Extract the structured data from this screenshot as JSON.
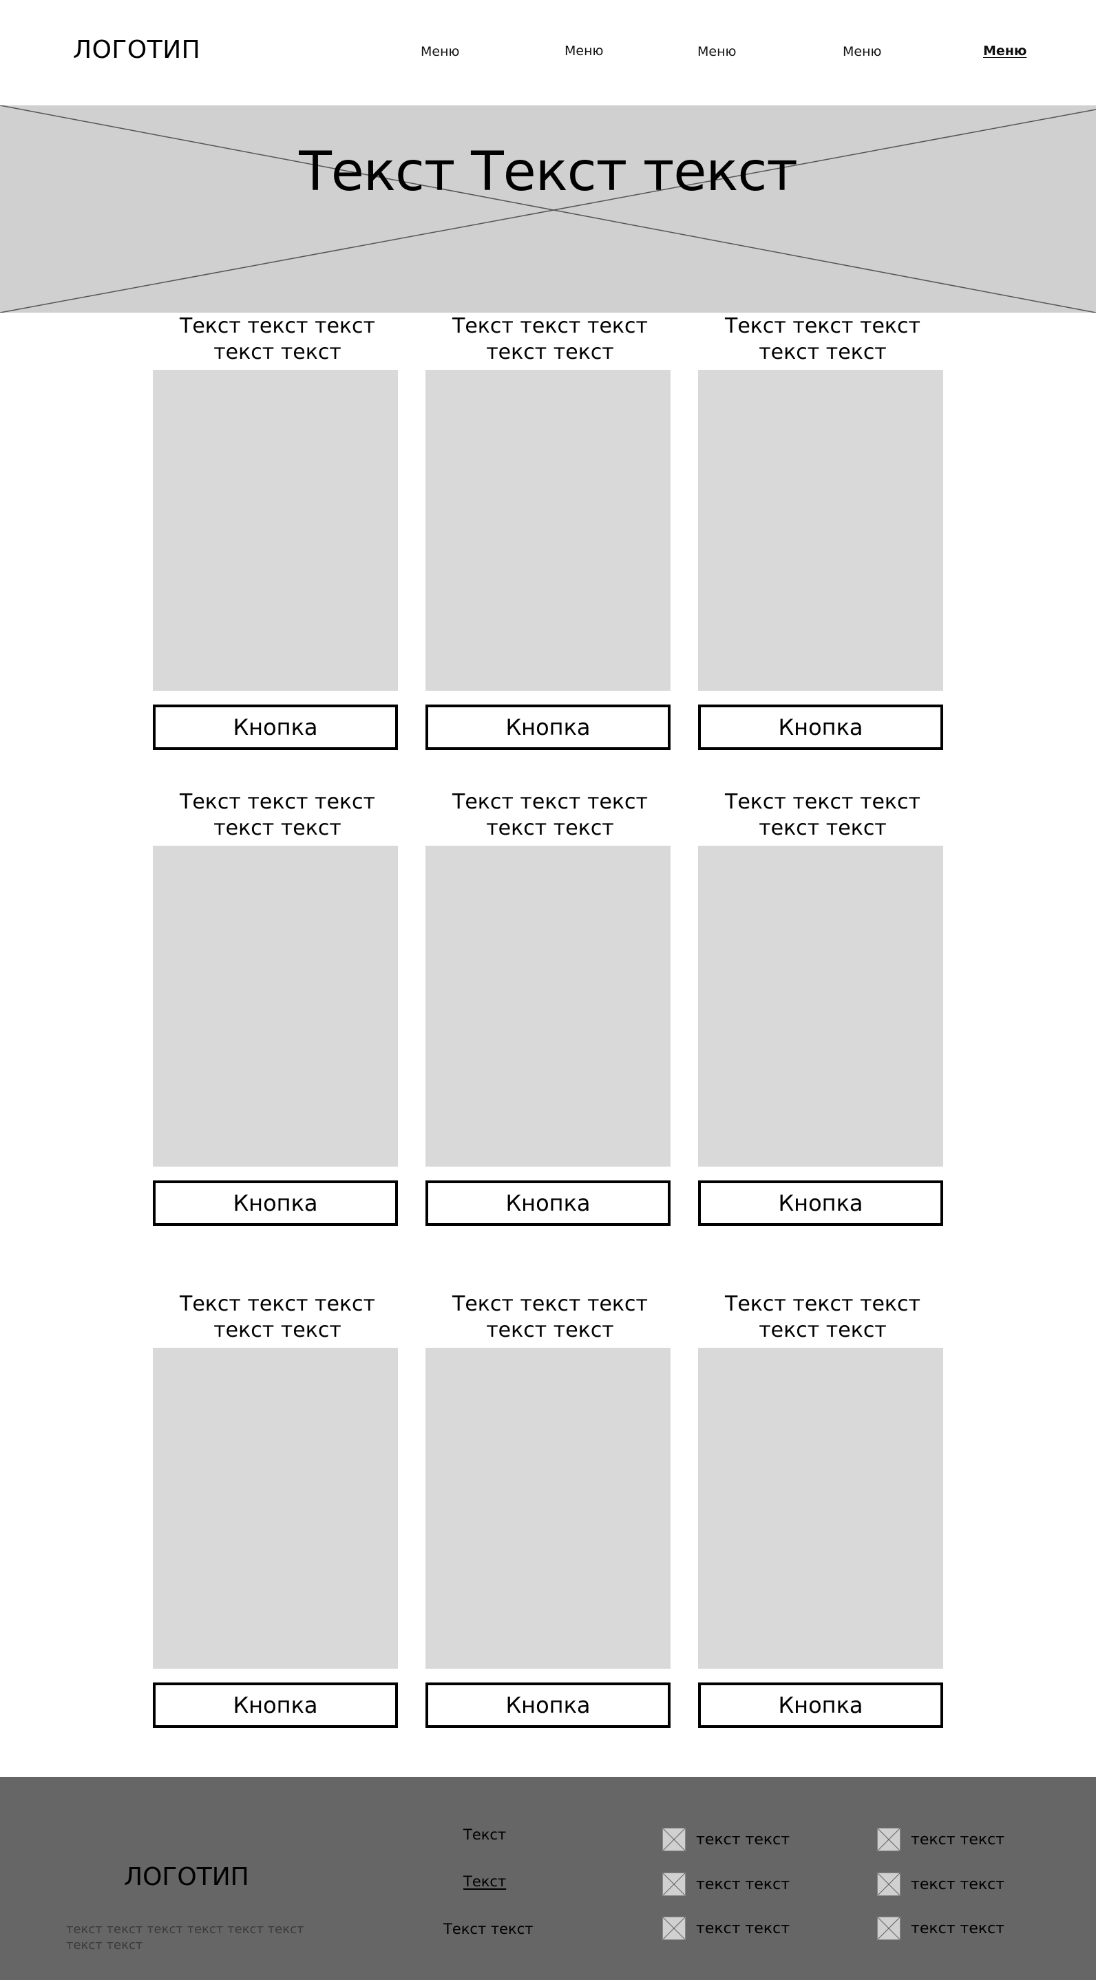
{
  "header": {
    "logo": "ЛОГОТИП",
    "menu": [
      {
        "label": "Меню"
      },
      {
        "label": "Меню"
      },
      {
        "label": "Меню"
      },
      {
        "label": "Меню"
      },
      {
        "label": "Меню",
        "active": true
      }
    ]
  },
  "hero": {
    "title": "Текст Текст текст"
  },
  "cards": [
    {
      "title_line1": "Текст текст текст",
      "title_line2": "текст текст",
      "button": "Кнопка"
    },
    {
      "title_line1": "Текст текст текст",
      "title_line2": "текст текст",
      "button": "Кнопка"
    },
    {
      "title_line1": "Текст текст текст",
      "title_line2": "текст текст",
      "button": "Кнопка"
    },
    {
      "title_line1": "Текст текст текст",
      "title_line2": "текст текст",
      "button": "Кнопка"
    },
    {
      "title_line1": "Текст текст текст",
      "title_line2": "текст текст",
      "button": "Кнопка"
    },
    {
      "title_line1": "Текст текст текст",
      "title_line2": "текст текст",
      "button": "Кнопка"
    },
    {
      "title_line1": "Текст текст текст",
      "title_line2": "текст текст",
      "button": "Кнопка"
    },
    {
      "title_line1": "Текст текст текст",
      "title_line2": "текст текст",
      "button": "Кнопка"
    },
    {
      "title_line1": "Текст текст текст",
      "title_line2": "текст текст",
      "button": "Кнопка"
    }
  ],
  "footer": {
    "logo": "ЛОГОТИП",
    "description": "текст текст текст текст текст текст текст текст",
    "links": [
      {
        "label": "Текст"
      },
      {
        "label": "Текст",
        "underlined": true
      },
      {
        "label": "Текст текст"
      }
    ],
    "items_col1": [
      {
        "label": "текст текст",
        "icon": "image-placeholder-icon"
      },
      {
        "label": "текст текст",
        "icon": "image-placeholder-icon"
      },
      {
        "label": "текст текст",
        "icon": "image-placeholder-icon"
      }
    ],
    "items_col2": [
      {
        "label": "текст текст",
        "icon": "image-placeholder-icon"
      },
      {
        "label": "текст текст",
        "icon": "image-placeholder-icon"
      },
      {
        "label": "текст текст",
        "icon": "image-placeholder-icon"
      }
    ]
  },
  "colors": {
    "hero_bg": "#d0d0d0",
    "card_image_bg": "#d9d9d9",
    "footer_bg": "#666666"
  }
}
